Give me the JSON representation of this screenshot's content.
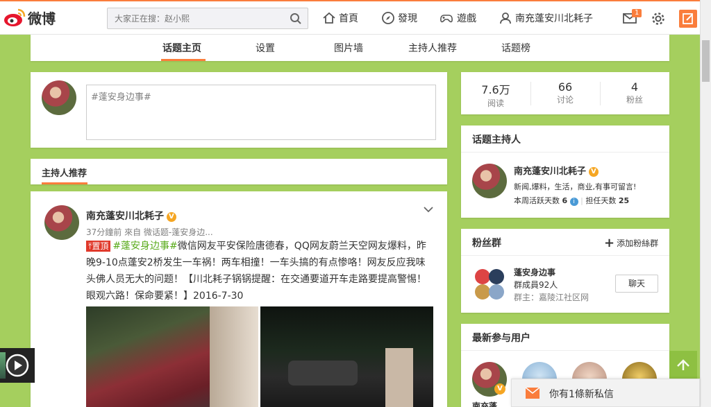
{
  "topbar": {
    "logo_text": "微博",
    "search_placeholder": "大家正在搜：赵小熙",
    "nav": [
      {
        "label": "首頁",
        "icon": "home-icon"
      },
      {
        "label": "發現",
        "icon": "compass-icon"
      },
      {
        "label": "遊戲",
        "icon": "gamepad-icon"
      },
      {
        "label": "南充蓬安川北耗子",
        "icon": "user-icon"
      }
    ],
    "message_badge": "1"
  },
  "tabs": [
    "话题主页",
    "设置",
    "图片墙",
    "主持人推荐",
    "话题榜"
  ],
  "composer": {
    "value": "#蓬安身边事#"
  },
  "recommend": {
    "title": "主持人推荐"
  },
  "post": {
    "author": "南充蓬安川北耗子",
    "meta": "37分鐘前 來自 微话题-蓬安身边...",
    "top_tag": "置頂",
    "topic": "#蓬安身边事#",
    "text": "微信网友平安保险唐德春，QQ网友蔚兰天空网友爆料，昨晚9-10点蓬安2桥发生一车祸！两车相撞！一车头搞的有点惨咯！网友反应我味头佛人员无大的问题！【川北耗子锅锅提醒：在交通要道开车走路要提高警惕！眼观六路！保命要紧！】2016-7-30"
  },
  "stats": [
    {
      "num": "7.6万",
      "label": "阅读"
    },
    {
      "num": "66",
      "label": "讨论"
    },
    {
      "num": "4",
      "label": "粉丝"
    }
  ],
  "host": {
    "title": "话题主持人",
    "name": "南充蓬安川北耗子",
    "desc": "新闻,爆料，生活，商业,有事可留言!",
    "active_label": "本周活跃天数",
    "active_days": "6",
    "host_label": "担任天数",
    "host_days": "25"
  },
  "fans": {
    "title": "粉丝群",
    "add_label": "添加粉絲群",
    "group_name": "蓬安身边事",
    "members": "群成員92人",
    "owner": "群主：嘉陵江社区网",
    "chat_label": "聊天"
  },
  "latest": {
    "title": "最新参与用户",
    "partial_name": "南充蓬"
  },
  "float_msg": {
    "text": "你有1條新私信"
  },
  "colors": {
    "accent": "#fa7d3c",
    "page_bg": "#a5cf5e",
    "topic": "#5aab1c"
  }
}
